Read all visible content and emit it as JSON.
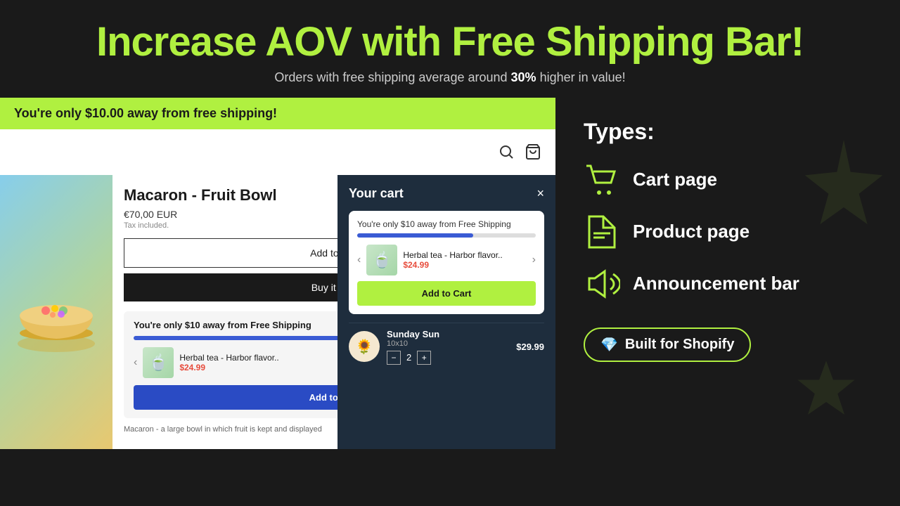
{
  "header": {
    "title": "Increase AOV with Free Shipping Bar!",
    "subtitle": "Orders with free shipping average around ",
    "subtitle_bold": "30%",
    "subtitle_end": " higher in value!"
  },
  "announcement_bar": {
    "text": "You're only $10.00 away from free shipping!"
  },
  "product": {
    "name": "Macaron - Fruit Bowl",
    "price": "€70,00 EUR",
    "tax": "Tax included.",
    "btn_cart": "Add to cart",
    "btn_buy": "Buy it now",
    "description": "Macaron - a large bowl in which fruit is kept and displayed"
  },
  "upsell_widget": {
    "title": "You're only $10 away from Free Shipping",
    "product_name": "Herbal tea - Harbor flavor..",
    "product_price": "$24.99",
    "btn_add": "Add to Cart"
  },
  "cart": {
    "title": "Your cart",
    "close": "×",
    "upsell": {
      "title": "You're only $10 away from Free Shipping",
      "product_name": "Herbal tea - Harbor flavor..",
      "product_price": "$24.99",
      "btn_add": "Add to Cart"
    },
    "item": {
      "name": "Sunday Sun",
      "variant": "10x10",
      "qty": "2",
      "price": "$29.99"
    }
  },
  "types": {
    "label": "Types:",
    "items": [
      {
        "icon": "cart-icon",
        "name": "Cart page"
      },
      {
        "icon": "tag-icon",
        "name": "Product page"
      },
      {
        "icon": "megaphone-icon",
        "name": "Announcement bar"
      }
    ]
  },
  "shopify_badge": {
    "gem": "💎",
    "text": "Built for Shopify"
  }
}
